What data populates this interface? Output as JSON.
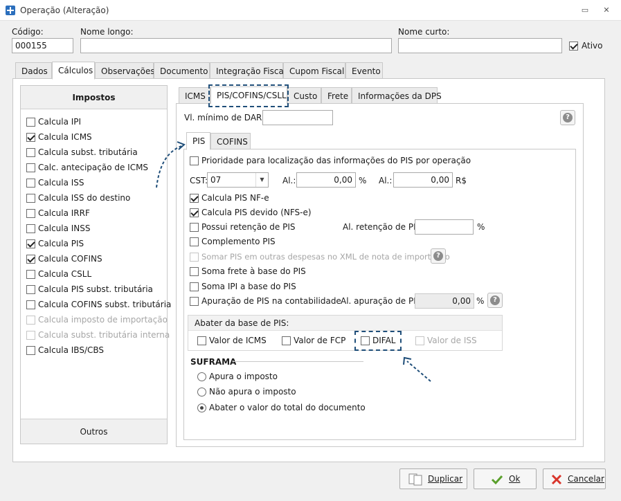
{
  "window": {
    "title": "Operação (Alteração)"
  },
  "header": {
    "codigo_label": "Código:",
    "codigo_value": "000155",
    "nome_longo_label": "Nome longo:",
    "nome_longo_value": "",
    "nome_curto_label": "Nome curto:",
    "nome_curto_value": "",
    "ativo_label": "Ativo",
    "ativo_checked": true
  },
  "main_tabs": [
    "Dados",
    "Cálculos",
    "Observações",
    "Documento",
    "Integração Fiscal",
    "Cupom Fiscal",
    "Evento"
  ],
  "impostos": {
    "title": "Impostos",
    "items": [
      {
        "label": "Calcula IPI",
        "checked": false,
        "enabled": true
      },
      {
        "label": "Calcula ICMS",
        "checked": true,
        "enabled": true
      },
      {
        "label": "Calcula subst. tributária",
        "checked": false,
        "enabled": true
      },
      {
        "label": "Calc. antecipação de ICMS",
        "checked": false,
        "enabled": true
      },
      {
        "label": "Calcula ISS",
        "checked": false,
        "enabled": true
      },
      {
        "label": "Calcula ISS do destino",
        "checked": false,
        "enabled": true
      },
      {
        "label": "Calcula IRRF",
        "checked": false,
        "enabled": true
      },
      {
        "label": "Calcula INSS",
        "checked": false,
        "enabled": true
      },
      {
        "label": "Calcula PIS",
        "checked": true,
        "enabled": true
      },
      {
        "label": "Calcula COFINS",
        "checked": true,
        "enabled": true
      },
      {
        "label": "Calcula CSLL",
        "checked": false,
        "enabled": true
      },
      {
        "label": "Calcula PIS subst. tributária",
        "checked": false,
        "enabled": true
      },
      {
        "label": "Calcula COFINS subst. tributária",
        "checked": false,
        "enabled": true
      },
      {
        "label": "Calcula imposto de importação",
        "checked": false,
        "enabled": false
      },
      {
        "label": "Calcula subst. tributária interna",
        "checked": false,
        "enabled": false
      },
      {
        "label": "Calcula IBS/CBS",
        "checked": false,
        "enabled": true
      }
    ],
    "outros_label": "Outros"
  },
  "sub_tabs": [
    "ICMS",
    "PIS/COFINS/CSLL",
    "Custo",
    "Frete",
    "Informações da DPS"
  ],
  "darf": {
    "label": "Vl. mínimo de DARF:",
    "value": ""
  },
  "pis_tabs": [
    "PIS",
    "COFINS"
  ],
  "pis": {
    "prioridade_label": "Prioridade para localização das informações do PIS por operação",
    "cst_label": "CST:",
    "cst_value": "07",
    "al_label": "Al.:",
    "al_value": "0,00",
    "al_unit": "%",
    "al2_label": "Al.:",
    "al2_value": "0,00",
    "al2_unit": "R$",
    "calcula_nfe": "Calcula PIS NF-e",
    "calcula_devido": "Calcula PIS devido (NFS-e)",
    "retencao": "Possui retenção de PIS",
    "al_retencao_label": "Al. retenção de PIS:",
    "al_retencao_value": "",
    "al_retencao_unit": "%",
    "complemento": "Complemento PIS",
    "somar": "Somar PIS em outras despesas no XML de nota de importação",
    "soma_frete": "Soma frete à base do PIS",
    "soma_ipi": "Soma IPI a base do PIS",
    "apuracao": "Apuração de PIS na contabilidade",
    "al_apuracao_label": "Al. apuração de PIS:",
    "al_apuracao_value": "0,00",
    "al_apuracao_unit": "%"
  },
  "abater": {
    "title": "Abater da base de PIS:",
    "items": [
      "Valor de ICMS",
      "Valor de FCP",
      "DIFAL",
      "Valor de ISS"
    ]
  },
  "suframa": {
    "title": "SUFRAMA",
    "options": [
      "Apura o imposto",
      "Não apura o imposto",
      "Abater o valor do total do documento"
    ],
    "selected": 2
  },
  "footer": {
    "duplicar": "Duplicar",
    "ok": "Ok",
    "cancelar": "Cancelar"
  },
  "colors": {
    "annotation": "#1f4e79",
    "ok_icon": "#5aa02c",
    "cancel_icon": "#d9342b"
  }
}
